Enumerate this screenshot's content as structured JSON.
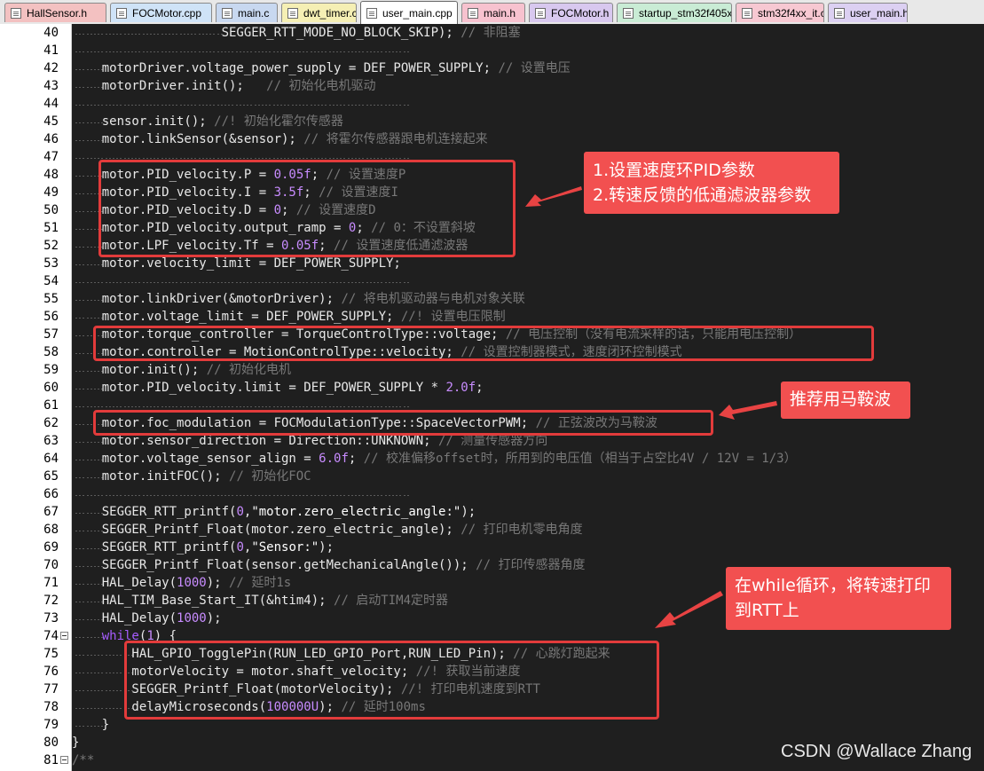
{
  "tabs": [
    {
      "label": "HallSensor.h",
      "color": "#f3c1c1",
      "active": false
    },
    {
      "label": "FOCMotor.cpp",
      "color": "#cfe3f7",
      "active": false
    },
    {
      "label": "main.c",
      "color": "#c8d8f0",
      "active": false
    },
    {
      "label": "dwt_timer.c",
      "color": "#f5efb4",
      "active": false
    },
    {
      "label": "user_main.cpp",
      "color": "#ffffff",
      "active": true
    },
    {
      "label": "main.h",
      "color": "#f7c2cf",
      "active": false
    },
    {
      "label": "FOCMotor.h",
      "color": "#d8c8ef",
      "active": false
    },
    {
      "label": "startup_stm32f405xx.s",
      "color": "#c9ecd5",
      "active": false
    },
    {
      "label": "stm32f4xx_it.c",
      "color": "#f7c8d2",
      "active": false
    },
    {
      "label": "user_main.h",
      "color": "#dcd0f2",
      "active": false
    }
  ],
  "lines": [
    {
      "n": "40",
      "fold": false,
      "parts": [
        [
          "c",
          "                    SEGGER_RTT_MODE_NO_BLOCK_SKIP); "
        ],
        [
          "cm",
          "// 非阻塞"
        ]
      ]
    },
    {
      "n": "41",
      "fold": false,
      "parts": []
    },
    {
      "n": "42",
      "fold": false,
      "parts": [
        [
          "c",
          "    motorDriver.voltage_power_supply = DEF_POWER_SUPPLY; "
        ],
        [
          "cm",
          "// 设置电压"
        ]
      ]
    },
    {
      "n": "43",
      "fold": false,
      "parts": [
        [
          "c",
          "    motorDriver.init();   "
        ],
        [
          "cm",
          "// 初始化电机驱动"
        ]
      ]
    },
    {
      "n": "44",
      "fold": false,
      "parts": []
    },
    {
      "n": "45",
      "fold": false,
      "parts": [
        [
          "c",
          "    sensor.init(); "
        ],
        [
          "cm",
          "//! 初始化霍尔传感器"
        ]
      ]
    },
    {
      "n": "46",
      "fold": false,
      "parts": [
        [
          "c",
          "    motor.linkSensor(&sensor); "
        ],
        [
          "cm",
          "// 将霍尔传感器跟电机连接起来"
        ]
      ]
    },
    {
      "n": "47",
      "fold": false,
      "parts": []
    },
    {
      "n": "48",
      "fold": false,
      "parts": [
        [
          "c",
          "    motor.PID_velocity.P = "
        ],
        [
          "num",
          "0.05f"
        ],
        [
          "c",
          "; "
        ],
        [
          "cm",
          "// 设置速度P"
        ]
      ]
    },
    {
      "n": "49",
      "fold": false,
      "parts": [
        [
          "c",
          "    motor.PID_velocity.I = "
        ],
        [
          "num",
          "3.5f"
        ],
        [
          "c",
          "; "
        ],
        [
          "cm",
          "// 设置速度I"
        ]
      ]
    },
    {
      "n": "50",
      "fold": false,
      "parts": [
        [
          "c",
          "    motor.PID_velocity.D = "
        ],
        [
          "num",
          "0"
        ],
        [
          "c",
          "; "
        ],
        [
          "cm",
          "// 设置速度D"
        ]
      ]
    },
    {
      "n": "51",
      "fold": false,
      "parts": [
        [
          "c",
          "    motor.PID_velocity.output_ramp = "
        ],
        [
          "num",
          "0"
        ],
        [
          "c",
          "; "
        ],
        [
          "cm",
          "// 0：不设置斜坡"
        ]
      ]
    },
    {
      "n": "52",
      "fold": false,
      "parts": [
        [
          "c",
          "    motor.LPF_velocity.Tf = "
        ],
        [
          "num",
          "0.05f"
        ],
        [
          "c",
          "; "
        ],
        [
          "cm",
          "// 设置速度低通滤波器"
        ]
      ]
    },
    {
      "n": "53",
      "fold": false,
      "parts": [
        [
          "c",
          "    motor.velocity_limit = DEF_POWER_SUPPLY;"
        ]
      ]
    },
    {
      "n": "54",
      "fold": false,
      "parts": []
    },
    {
      "n": "55",
      "fold": false,
      "parts": [
        [
          "c",
          "    motor.linkDriver(&motorDriver); "
        ],
        [
          "cm",
          "// 将电机驱动器与电机对象关联"
        ]
      ]
    },
    {
      "n": "56",
      "fold": false,
      "parts": [
        [
          "c",
          "    motor.voltage_limit = DEF_POWER_SUPPLY; "
        ],
        [
          "cm",
          "//! 设置电压限制"
        ]
      ]
    },
    {
      "n": "57",
      "fold": false,
      "parts": [
        [
          "c",
          "    motor.torque_controller = TorqueControlType::voltage; "
        ],
        [
          "cm",
          "// 电压控制（没有电流采样的话，只能用电压控制）"
        ]
      ]
    },
    {
      "n": "58",
      "fold": false,
      "parts": [
        [
          "c",
          "    motor.controller = MotionControlType::velocity; "
        ],
        [
          "cm",
          "// 设置控制器模式，速度闭环控制模式"
        ]
      ]
    },
    {
      "n": "59",
      "fold": false,
      "parts": [
        [
          "c",
          "    motor.init(); "
        ],
        [
          "cm",
          "// 初始化电机"
        ]
      ]
    },
    {
      "n": "60",
      "fold": false,
      "parts": [
        [
          "c",
          "    motor.PID_velocity.limit = DEF_POWER_SUPPLY * "
        ],
        [
          "num",
          "2.0f"
        ],
        [
          "c",
          ";"
        ]
      ]
    },
    {
      "n": "61",
      "fold": false,
      "parts": []
    },
    {
      "n": "62",
      "fold": false,
      "parts": [
        [
          "c",
          "    motor.foc_modulation = FOCModulationType::SpaceVectorPWM; "
        ],
        [
          "cm",
          "// 正弦波改为马鞍波"
        ]
      ]
    },
    {
      "n": "63",
      "fold": false,
      "parts": [
        [
          "c",
          "    motor.sensor_direction = Direction::UNKNOWN; "
        ],
        [
          "cm",
          "// 测量传感器方向"
        ]
      ]
    },
    {
      "n": "64",
      "fold": false,
      "parts": [
        [
          "c",
          "    motor.voltage_sensor_align = "
        ],
        [
          "num",
          "6.0f"
        ],
        [
          "c",
          "; "
        ],
        [
          "cm",
          "// 校准偏移offset时，所用到的电压值（相当于占空比4V / 12V = 1/3）"
        ]
      ]
    },
    {
      "n": "65",
      "fold": false,
      "parts": [
        [
          "c",
          "    motor.initFOC(); "
        ],
        [
          "cm",
          "// 初始化FOC"
        ]
      ]
    },
    {
      "n": "66",
      "fold": false,
      "parts": []
    },
    {
      "n": "67",
      "fold": false,
      "parts": [
        [
          "c",
          "    SEGGER_RTT_printf("
        ],
        [
          "num",
          "0"
        ],
        [
          "c",
          ","
        ],
        [
          "str",
          "\"motor.zero_electric_angle:\""
        ],
        [
          "c",
          ");"
        ]
      ]
    },
    {
      "n": "68",
      "fold": false,
      "parts": [
        [
          "c",
          "    SEGGER_Printf_Float(motor.zero_electric_angle); "
        ],
        [
          "cm",
          "// 打印电机零电角度"
        ]
      ]
    },
    {
      "n": "69",
      "fold": false,
      "parts": [
        [
          "c",
          "    SEGGER_RTT_printf("
        ],
        [
          "num",
          "0"
        ],
        [
          "c",
          ","
        ],
        [
          "str",
          "\"Sensor:\""
        ],
        [
          "c",
          ");"
        ]
      ]
    },
    {
      "n": "70",
      "fold": false,
      "parts": [
        [
          "c",
          "    SEGGER_Printf_Float(sensor.getMechanicalAngle()); "
        ],
        [
          "cm",
          "// 打印传感器角度"
        ]
      ]
    },
    {
      "n": "71",
      "fold": false,
      "parts": [
        [
          "c",
          "    HAL_Delay("
        ],
        [
          "num",
          "1000"
        ],
        [
          "c",
          "); "
        ],
        [
          "cm",
          "// 延时1s"
        ]
      ]
    },
    {
      "n": "72",
      "fold": false,
      "parts": [
        [
          "c",
          "    HAL_TIM_Base_Start_IT(&htim4); "
        ],
        [
          "cm",
          "// 启动TIM4定时器"
        ]
      ]
    },
    {
      "n": "73",
      "fold": false,
      "parts": [
        [
          "c",
          "    HAL_Delay("
        ],
        [
          "num",
          "1000"
        ],
        [
          "c",
          ");"
        ]
      ]
    },
    {
      "n": "74",
      "fold": true,
      "parts": [
        [
          "c",
          "    "
        ],
        [
          "kw",
          "while"
        ],
        [
          "c",
          "("
        ],
        [
          "num",
          "1"
        ],
        [
          "c",
          ") {"
        ]
      ]
    },
    {
      "n": "75",
      "fold": false,
      "parts": [
        [
          "c",
          "        HAL_GPIO_TogglePin(RUN_LED_GPIO_Port,RUN_LED_Pin); "
        ],
        [
          "cm",
          "// 心跳灯跑起来"
        ]
      ]
    },
    {
      "n": "76",
      "fold": false,
      "parts": [
        [
          "c",
          "        motorVelocity = motor.shaft_velocity; "
        ],
        [
          "cm",
          "//! 获取当前速度"
        ]
      ]
    },
    {
      "n": "77",
      "fold": false,
      "parts": [
        [
          "c",
          "        SEGGER_Printf_Float(motorVelocity); "
        ],
        [
          "cm",
          "//! 打印电机速度到RTT"
        ]
      ]
    },
    {
      "n": "78",
      "fold": false,
      "parts": [
        [
          "c",
          "        delayMicroseconds("
        ],
        [
          "num",
          "100000U"
        ],
        [
          "c",
          "); "
        ],
        [
          "cm",
          "// 延时100ms"
        ]
      ]
    },
    {
      "n": "79",
      "fold": false,
      "parts": [
        [
          "c",
          "    }"
        ]
      ]
    },
    {
      "n": "80",
      "fold": false,
      "parts": [
        [
          "c",
          "}"
        ]
      ]
    },
    {
      "n": "81",
      "fold": true,
      "parts": [
        [
          "cm",
          "/**"
        ]
      ]
    }
  ],
  "callouts": {
    "pid_line1": "1.设置速度环PID参数",
    "pid_line2": "2.转速反馈的低通滤波器参数",
    "svpwm": "推荐用马鞍波",
    "loop_line1": "在while循环，将转速打印",
    "loop_line2": "到RTT上"
  },
  "watermark": "CSDN @Wallace Zhang",
  "colors": {
    "editor_bg": "#1f1f1f",
    "comment": "#787878",
    "number": "#c88cff",
    "keyword": "#a65cff",
    "highlight_red": "#e23b3b",
    "callout_bg": "#f25050"
  }
}
